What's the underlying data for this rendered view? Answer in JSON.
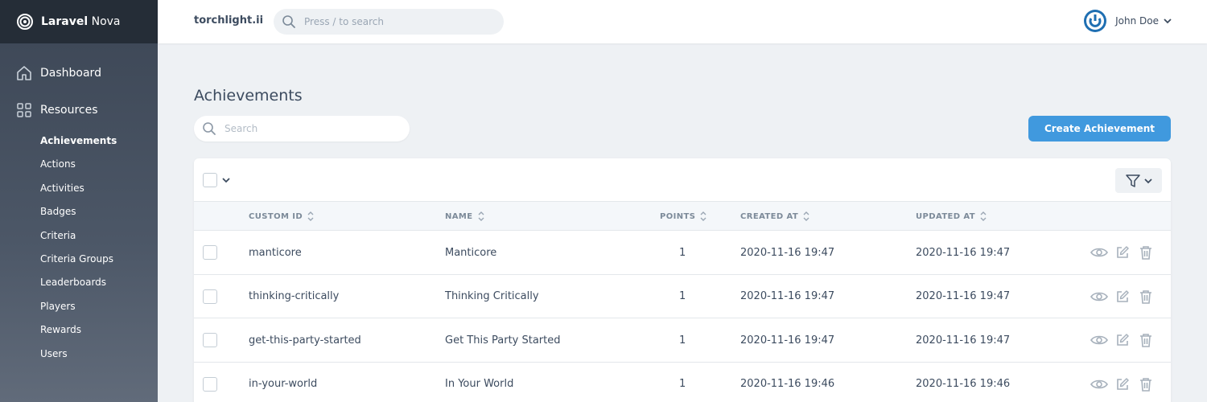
{
  "brand": {
    "name_bold": "Laravel",
    "name_rest": " Nova"
  },
  "sidebar": {
    "dashboard_label": "Dashboard",
    "resources_label": "Resources",
    "items": [
      {
        "label": "Achievements",
        "active": true
      },
      {
        "label": "Actions"
      },
      {
        "label": "Activities"
      },
      {
        "label": "Badges"
      },
      {
        "label": "Criteria"
      },
      {
        "label": "Criteria Groups"
      },
      {
        "label": "Leaderboards"
      },
      {
        "label": "Players"
      },
      {
        "label": "Rewards"
      },
      {
        "label": "Users"
      }
    ]
  },
  "header": {
    "app_name": "torchlight.ii",
    "search_placeholder": "Press / to search",
    "user_name": "John Doe"
  },
  "main": {
    "title": "Achievements",
    "search_placeholder": "Search",
    "create_label": "Create Achievement"
  },
  "table": {
    "columns": [
      "CUSTOM ID",
      "NAME",
      "POINTS",
      "CREATED AT",
      "UPDATED AT"
    ],
    "rows": [
      {
        "custom_id": "manticore",
        "name": "Manticore",
        "points": "1",
        "created_at": "2020-11-16 19:47",
        "updated_at": "2020-11-16 19:47"
      },
      {
        "custom_id": "thinking-critically",
        "name": "Thinking Critically",
        "points": "1",
        "created_at": "2020-11-16 19:47",
        "updated_at": "2020-11-16 19:47"
      },
      {
        "custom_id": "get-this-party-started",
        "name": "Get This Party Started",
        "points": "1",
        "created_at": "2020-11-16 19:47",
        "updated_at": "2020-11-16 19:47"
      },
      {
        "custom_id": "in-your-world",
        "name": "In Your World",
        "points": "1",
        "created_at": "2020-11-16 19:46",
        "updated_at": "2020-11-16 19:46"
      }
    ]
  },
  "colors": {
    "accent": "#4099de",
    "sidebar": "#3c4655",
    "brand_bar": "#252d37",
    "background": "#eef1f4"
  },
  "icons": [
    "nova-logo-icon",
    "home-icon",
    "grid-icon",
    "search-icon",
    "user-avatar-icon",
    "chevron-down-icon",
    "filter-icon",
    "sort-icon",
    "view-icon",
    "edit-icon",
    "delete-icon"
  ]
}
